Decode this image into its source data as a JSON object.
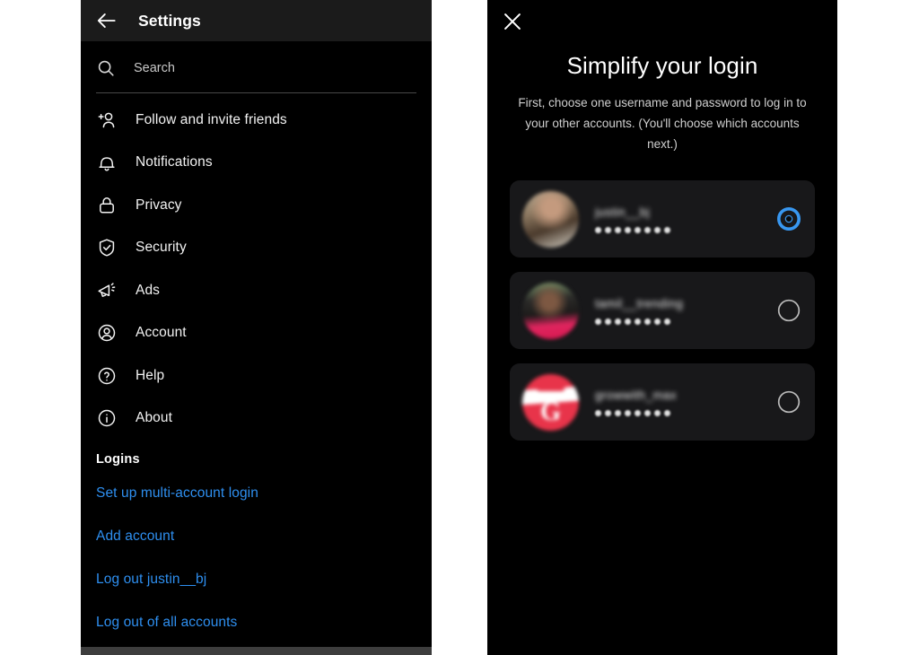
{
  "page": {
    "background": "#ffffff",
    "panel_background": "#000000",
    "accent_link_color": "#2e8ff0",
    "selected_radio_color": "#3897f0"
  },
  "settings_screen": {
    "appbar": {
      "back_icon": "arrow-left-icon",
      "title": "Settings"
    },
    "search": {
      "icon": "search-icon",
      "placeholder": "Search",
      "value": ""
    },
    "menu_items": [
      {
        "icon": "person-add-icon",
        "label": "Follow and invite friends"
      },
      {
        "icon": "bell-icon",
        "label": "Notifications"
      },
      {
        "icon": "lock-icon",
        "label": "Privacy"
      },
      {
        "icon": "shield-check-icon",
        "label": "Security"
      },
      {
        "icon": "megaphone-icon",
        "label": "Ads"
      },
      {
        "icon": "account-circle-icon",
        "label": "Account"
      },
      {
        "icon": "question-circle-icon",
        "label": "Help"
      },
      {
        "icon": "info-circle-icon",
        "label": "About"
      }
    ],
    "logins_section": {
      "heading": "Logins",
      "links": [
        "Set up multi-account login",
        "Add account",
        "Log out justin__bj",
        "Log out of all accounts"
      ]
    }
  },
  "simplify_screen": {
    "close_icon": "close-icon",
    "title": "Simplify your login",
    "description": "First, choose one username and password to log in to your other accounts. (You'll choose which accounts next.)",
    "accounts": [
      {
        "username": "justin__bj",
        "password_masked": "••••••••",
        "avatar": "photo-person-avatar",
        "selected": true,
        "radio_icon": "radio-selected-icon"
      },
      {
        "username": "tamil__trending",
        "password_masked": "••••••••",
        "avatar": "photo-person-avatar",
        "selected": false,
        "radio_icon": "radio-unselected-icon"
      },
      {
        "username": "growwith_max",
        "password_masked": "••••••••",
        "avatar": "g-logo-avatar",
        "avatar_letter": "G",
        "selected": false,
        "radio_icon": "radio-unselected-icon"
      }
    ]
  }
}
